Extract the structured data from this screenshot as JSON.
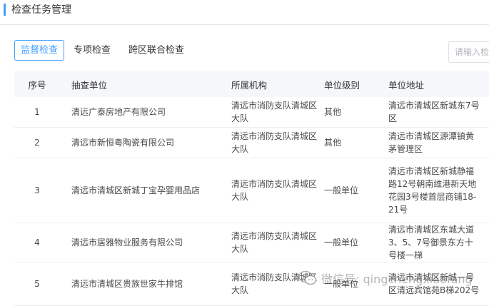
{
  "header": {
    "title": "检查任务管理"
  },
  "tabs": [
    {
      "label": "监督检查",
      "active": true
    },
    {
      "label": "专项检查",
      "active": false
    },
    {
      "label": "跨区联合检查",
      "active": false
    }
  ],
  "search": {
    "placeholder": "请输入检查"
  },
  "table": {
    "columns": [
      "序号",
      "抽查单位",
      "所属机构",
      "单位级别",
      "单位地址"
    ],
    "rows": [
      {
        "no": "1",
        "unit": "清远广泰房地产有限公司",
        "org": "清远市消防支队清城区大队",
        "level": "其他",
        "address": "清远市清城区新城东7号区"
      },
      {
        "no": "2",
        "unit": "清远市新恒粤陶瓷有限公司",
        "org": "清远市消防支队清城区大队",
        "level": "其他",
        "address": "清远市清城区源潭镇黄茅管理区"
      },
      {
        "no": "3",
        "unit": "清远市清城区新城丁宝孕婴用品店",
        "org": "清远市消防支队清城区大队",
        "level": "一般单位",
        "address": "清远市清城区新城静福路12号朝南维港新天地花园3号楼首层商铺18-21号"
      },
      {
        "no": "4",
        "unit": "清远市居雅物业服务有限公司",
        "org": "清远市消防支队清城区大队",
        "level": "一般单位",
        "address": "清远市清城区东城大道3、5、7号御景东方十号楼一梯"
      },
      {
        "no": "5",
        "unit": "清远市清城区贵族世家牛排馆",
        "org": "清远市消防支队清城区大队",
        "level": "一般单位",
        "address": "清远市清城区新城一号区清远宾馆苑B梯202号"
      }
    ]
  },
  "watermark": {
    "text": "微信号: qingchengxiaofang",
    "icon": "wechat-icon"
  },
  "colors": {
    "accent": "#409eff",
    "header_bg": "#f5f7fa",
    "border": "#ebeef5"
  }
}
